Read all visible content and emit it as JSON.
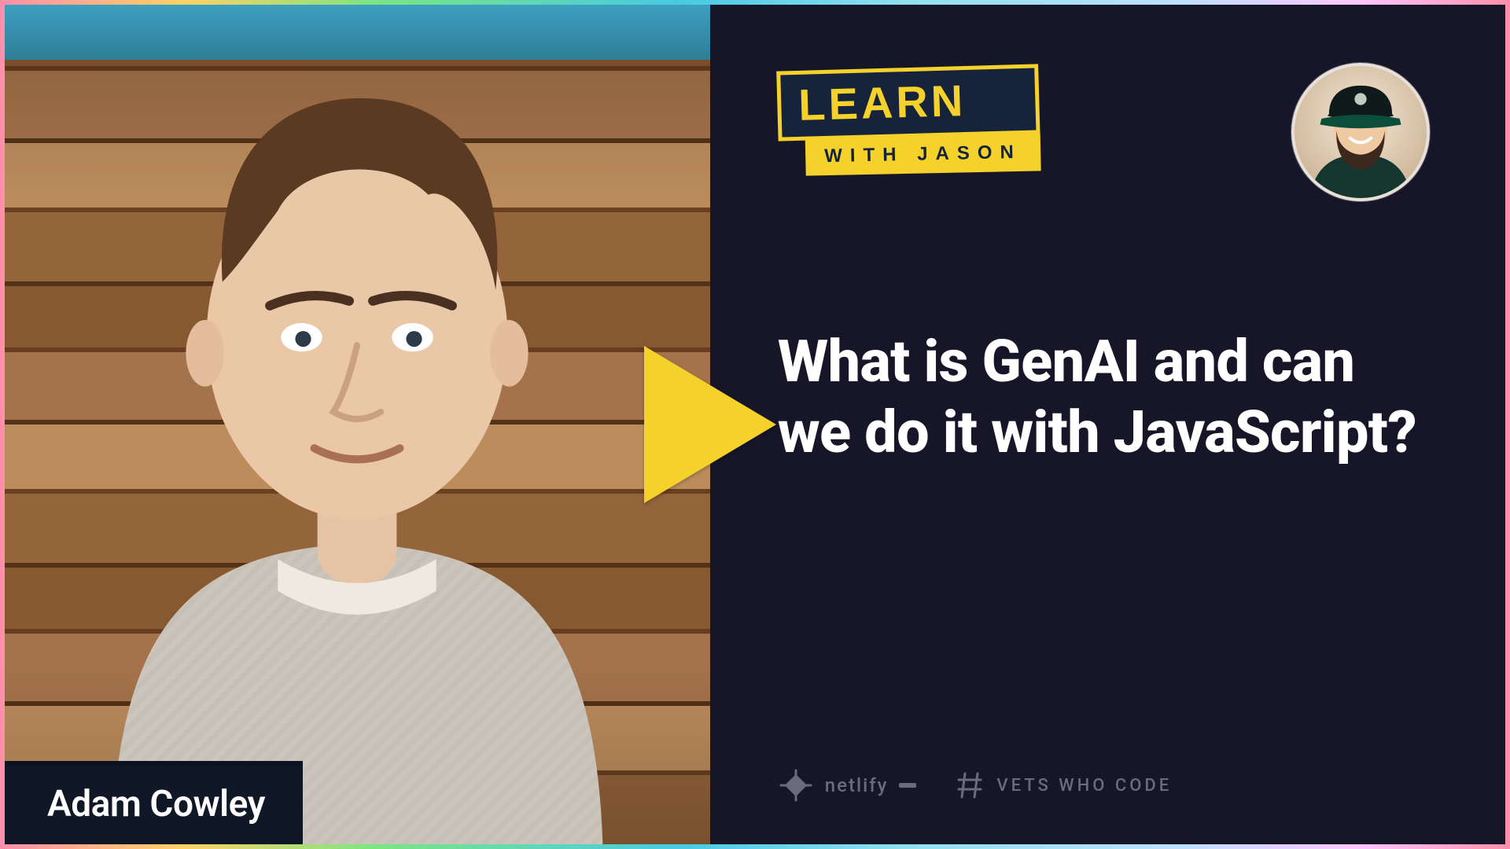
{
  "show": {
    "logo_top": "LEARN",
    "logo_bottom": "WITH JASON"
  },
  "guest": {
    "name": "Adam Cowley"
  },
  "episode": {
    "title": "What is GenAI and can we do it with JavaScript?"
  },
  "sponsors": [
    {
      "id": "netlify",
      "label": "netlify"
    },
    {
      "id": "vetswhocode",
      "label": "VETS WHO CODE"
    }
  ],
  "colors": {
    "accent_yellow": "#f4d22b",
    "panel_dark": "#171629",
    "name_bar": "#101828"
  }
}
